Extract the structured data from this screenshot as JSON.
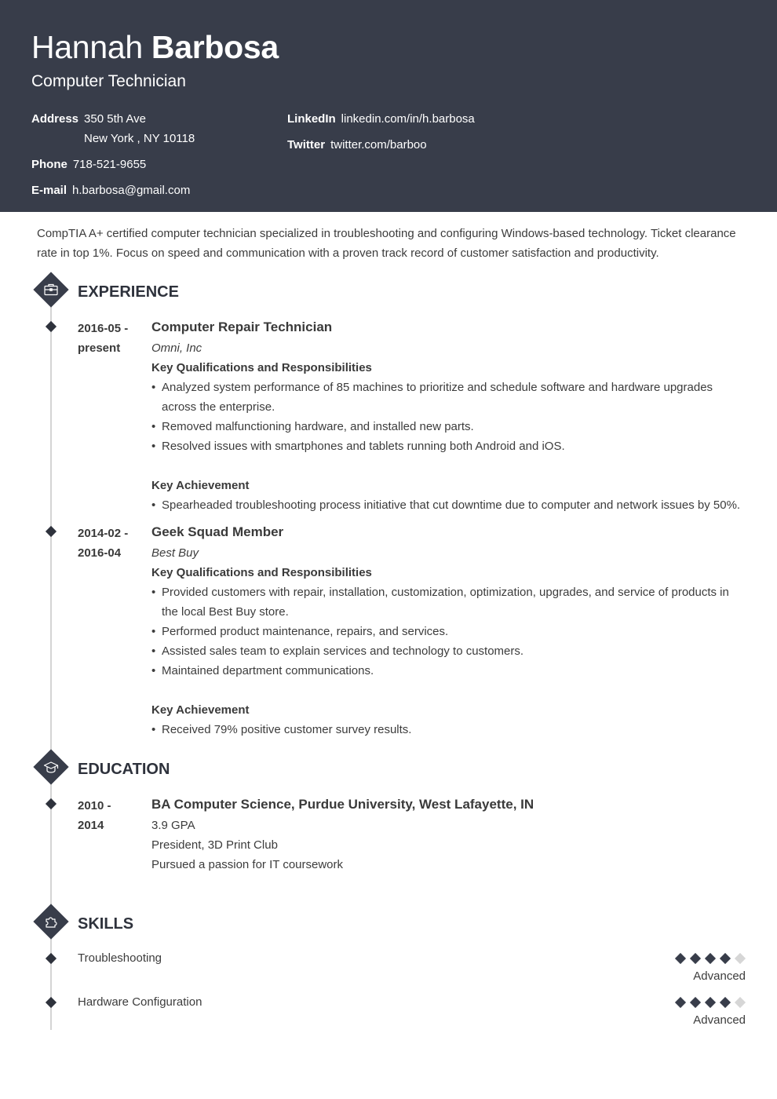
{
  "header": {
    "first_name": "Hannah",
    "last_name": "Barbosa",
    "role": "Computer Technician",
    "contacts": {
      "address_label": "Address",
      "address_line1": "350 5th Ave",
      "address_line2": "New York , NY 10118",
      "phone_label": "Phone",
      "phone": "718-521-9655",
      "email_label": "E-mail",
      "email": "h.barbosa@gmail.com",
      "linkedin_label": "LinkedIn",
      "linkedin": "linkedin.com/in/h.barbosa",
      "twitter_label": "Twitter",
      "twitter": "twitter.com/barboo"
    }
  },
  "summary": "CompTIA A+ certified computer technician specialized in troubleshooting and configuring Windows-based technology. Ticket clearance rate in top 1%. Focus on speed and communication with a proven track record of customer satisfaction and productivity.",
  "experience": {
    "title": "EXPERIENCE",
    "icon": "briefcase-icon",
    "jobs": [
      {
        "date_start": "2016-05 -",
        "date_end": "present",
        "title": "Computer Repair Technician",
        "company": "Omni, Inc",
        "qual_heading": "Key Qualifications and Responsibilities",
        "bullets": [
          "Analyzed system performance of 85 machines to prioritize and schedule software and hardware upgrades across the enterprise.",
          "Removed malfunctioning hardware, and installed new parts.",
          "Resolved issues with smartphones and tablets running both Android and iOS."
        ],
        "achievement_heading": "Key Achievement",
        "achievements": [
          "Spearheaded troubleshooting process initiative that cut downtime due to computer and network issues by 50%."
        ]
      },
      {
        "date_start": "2014-02 -",
        "date_end": "2016-04",
        "title": "Geek Squad Member",
        "company": "Best Buy",
        "qual_heading": "Key Qualifications and Responsibilities",
        "bullets": [
          "Provided customers with repair, installation, customization, optimization, upgrades, and service of products in the local Best Buy store.",
          "Performed product maintenance, repairs, and services.",
          "Assisted sales team to explain services and technology to customers.",
          "Maintained department communications."
        ],
        "achievement_heading": "Key Achievement",
        "achievements": [
          "Received 79% positive customer survey results."
        ]
      }
    ]
  },
  "education": {
    "title": "EDUCATION",
    "icon": "graduation-cap-icon",
    "items": [
      {
        "date_start": "2010 -",
        "date_end": "2014",
        "degree": "BA Computer Science, Purdue University, West Lafayette, IN",
        "details": [
          "3.9 GPA",
          "President, 3D Print Club",
          "Pursued a passion for IT coursework"
        ]
      }
    ]
  },
  "skills": {
    "title": "SKILLS",
    "icon": "puzzle-piece-icon",
    "items": [
      {
        "name": "Troubleshooting",
        "rating": 4,
        "max": 5,
        "level": "Advanced"
      },
      {
        "name": "Hardware Configuration",
        "rating": 4,
        "max": 5,
        "level": "Advanced"
      }
    ]
  }
}
